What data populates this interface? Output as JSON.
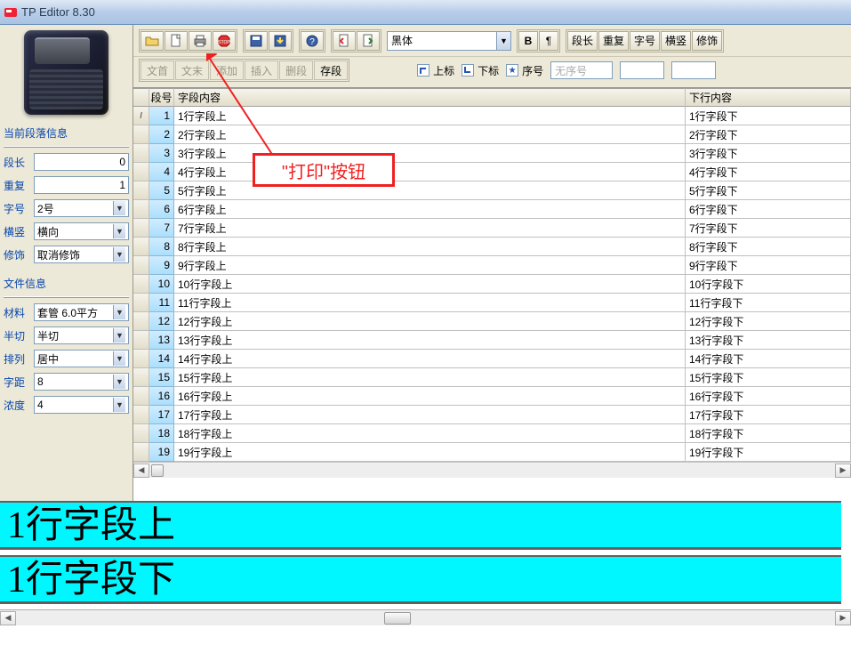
{
  "app": {
    "title": "TP Editor  8.30"
  },
  "toolbar": {
    "font_select": "黑体",
    "opt_labels": [
      "段长",
      "重复",
      "字号",
      "横竖",
      "修饰"
    ],
    "row2": {
      "seg1": [
        "文首",
        "文末",
        "添加",
        "插入",
        "删段",
        "存段"
      ],
      "chk_up": "上标",
      "chk_down": "下标",
      "chk_seq": "序号",
      "seq_placeholder": "无序号"
    }
  },
  "left": {
    "panel1_title": "当前段落信息",
    "fields1": {
      "seglen": {
        "label": "段长",
        "value": "0"
      },
      "repeat": {
        "label": "重复",
        "value": "1"
      },
      "fontno": {
        "label": "字号",
        "value": "2号"
      },
      "orient": {
        "label": "横竖",
        "value": "横向"
      },
      "decor": {
        "label": "修饰",
        "value": "取消修饰"
      }
    },
    "panel2_title": "文件信息",
    "fields2": {
      "material": {
        "label": "材料",
        "value": "套管 6.0平方"
      },
      "halfcut": {
        "label": "半切",
        "value": "半切"
      },
      "align": {
        "label": "排列",
        "value": "居中"
      },
      "spacing": {
        "label": "字距",
        "value": "8"
      },
      "density": {
        "label": "浓度",
        "value": "4"
      }
    }
  },
  "grid": {
    "headers": {
      "gutter": "",
      "num": "段号",
      "a": "字段内容",
      "b": "下行内容"
    },
    "rows": [
      {
        "n": 1,
        "a": "1行字段上",
        "b": "1行字段下"
      },
      {
        "n": 2,
        "a": "2行字段上",
        "b": "2行字段下"
      },
      {
        "n": 3,
        "a": "3行字段上",
        "b": "3行字段下"
      },
      {
        "n": 4,
        "a": "4行字段上",
        "b": "4行字段下"
      },
      {
        "n": 5,
        "a": "5行字段上",
        "b": "5行字段下"
      },
      {
        "n": 6,
        "a": "6行字段上",
        "b": "6行字段下"
      },
      {
        "n": 7,
        "a": "7行字段上",
        "b": "7行字段下"
      },
      {
        "n": 8,
        "a": "8行字段上",
        "b": "8行字段下"
      },
      {
        "n": 9,
        "a": "9行字段上",
        "b": "9行字段下"
      },
      {
        "n": 10,
        "a": "10行字段上",
        "b": "10行字段下"
      },
      {
        "n": 11,
        "a": "11行字段上",
        "b": "11行字段下"
      },
      {
        "n": 12,
        "a": "12行字段上",
        "b": "12行字段下"
      },
      {
        "n": 13,
        "a": "13行字段上",
        "b": "13行字段下"
      },
      {
        "n": 14,
        "a": "14行字段上",
        "b": "14行字段下"
      },
      {
        "n": 15,
        "a": "15行字段上",
        "b": "15行字段下"
      },
      {
        "n": 16,
        "a": "16行字段上",
        "b": "16行字段下"
      },
      {
        "n": 17,
        "a": "17行字段上",
        "b": "17行字段下"
      },
      {
        "n": 18,
        "a": "18行字段上",
        "b": "18行字段下"
      },
      {
        "n": 19,
        "a": "19行字段上",
        "b": "19行字段下"
      }
    ]
  },
  "preview": {
    "upper": "1行字段上",
    "lower": "1行字段下"
  },
  "annotation": {
    "callout_text": "\"打印\"按钮"
  }
}
